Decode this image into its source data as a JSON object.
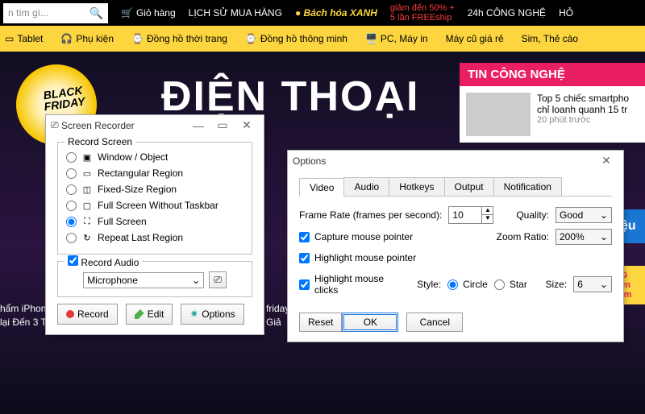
{
  "site": {
    "search_placeholder": "n tìm gì...",
    "topnav": {
      "cart": "Giỏ hàng",
      "history": "LỊCH SỬ MUA HÀNG",
      "brand": "Bách hóa XANH",
      "promo_lines": [
        "giảm đến 50% +",
        "5 lần FREEship"
      ],
      "news24": "24h CÔNG NGHỆ",
      "ask": "HỎ"
    },
    "catnav": [
      "Tablet",
      "Phụ kiện",
      "Đồng hồ thời trang",
      "Đồng hồ thông minh",
      "PC, Máy in",
      "Máy cũ giá rẻ",
      "Sim, Thẻ cào"
    ],
    "banner_headline": "ĐIỆN THOẠI",
    "black_friday": "BLACK FRIDAY",
    "news": {
      "header": "TIN CÔNG NGHỆ",
      "item_title": "Top 5 chiếc smartpho chỉ loanh quanh 15 tr",
      "item_time": "20 phút trước"
    },
    "deal_badge": "riệu",
    "promo_mini": "Gảm iảm",
    "thin1": "hẩm iPhon",
    "thin2": "lại Đến 3 Tr",
    "thin3": "friday",
    "thin4": "Giả"
  },
  "recorder": {
    "title": "Screen Recorder",
    "group_record": "Record Screen",
    "opts": {
      "window": "Window / Object",
      "rect": "Rectangular Region",
      "fixed": "Fixed-Size Region",
      "full_nt": "Full Screen Without Taskbar",
      "full": "Full Screen",
      "repeat": "Repeat Last Region"
    },
    "group_audio": "Record Audio",
    "audio_source": "Microphone",
    "btn_record": "Record",
    "btn_edit": "Edit",
    "btn_options": "Options"
  },
  "options": {
    "title": "Options",
    "tabs": [
      "Video",
      "Audio",
      "Hotkeys",
      "Output",
      "Notification"
    ],
    "framerate_label": "Frame Rate (frames per second):",
    "framerate_value": "10",
    "quality_label": "Quality:",
    "quality_value": "Good",
    "zoom_label": "Zoom Ratio:",
    "zoom_value": "200%",
    "capture_ptr": "Capture mouse pointer",
    "hl_ptr": "Highlight mouse pointer",
    "hl_clicks": "Highlight mouse clicks",
    "style_label": "Style:",
    "style_circle": "Circle",
    "style_star": "Star",
    "size_label": "Size:",
    "size_value": "6",
    "btn_reset": "Reset",
    "btn_ok": "OK",
    "btn_cancel": "Cancel"
  }
}
